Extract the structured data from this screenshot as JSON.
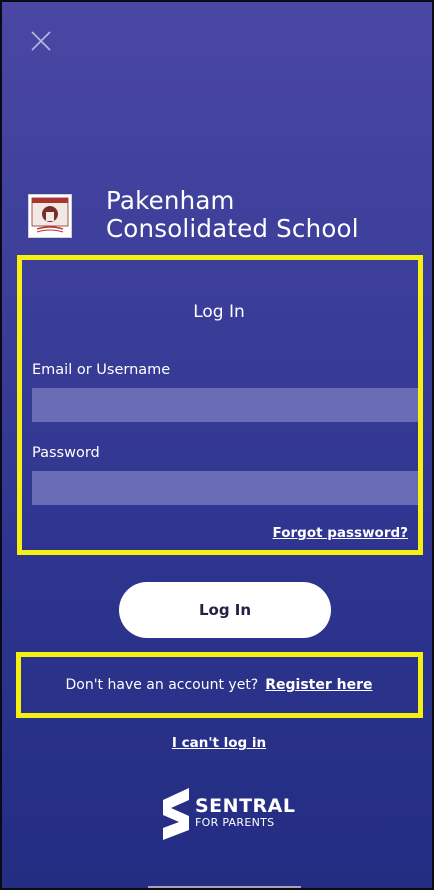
{
  "school": {
    "name_line1": "Pakenham",
    "name_line2": "Consolidated School"
  },
  "login_form": {
    "title": "Log In",
    "email_label": "Email or Username",
    "email_value": "",
    "password_label": "Password",
    "password_value": "",
    "forgot_password": "Forgot password?"
  },
  "login_button_label": "Log In",
  "register": {
    "prompt": "Don't have an account yet?",
    "link": "Register here"
  },
  "cant_login": "I can't log in",
  "brand": {
    "name": "SENTRAL",
    "tagline": "FOR PARENTS"
  },
  "icons": {
    "close": "close-icon",
    "school_logo": "school-crest-icon",
    "sentral_logo": "sentral-s-icon"
  },
  "colors": {
    "background_top": "#4a47a4",
    "background_bottom": "#232d82",
    "highlight": "#f5ef12",
    "input_fill": "#6b6cb6"
  }
}
